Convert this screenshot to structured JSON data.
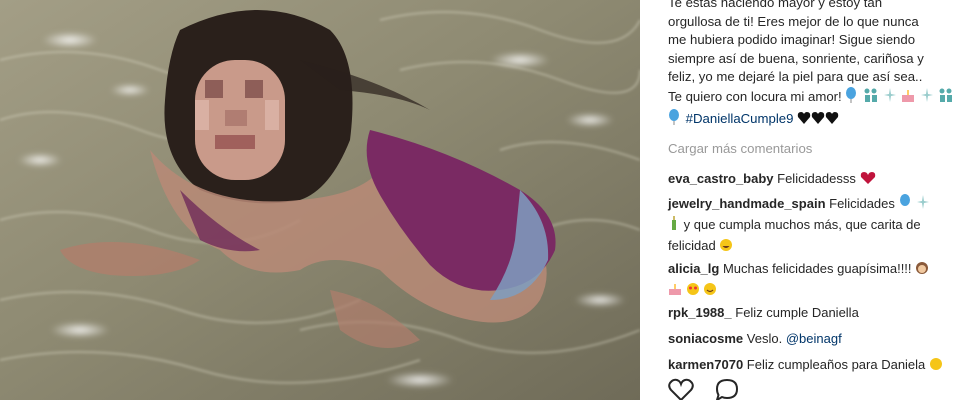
{
  "caption": {
    "lines": [
      "Te estás haciendo mayor y estoy tan",
      "orgullosa de ti! Eres mejor de lo que nunca",
      "me hubiera podido imaginar! Sigue siendo",
      "siempre así de buena, sonriente, cariñosa y",
      "feliz, yo me dejaré la piel para que así sea..",
      "Te quiero con locura mi amor!"
    ],
    "hashtag": "#DaniellaCumple9"
  },
  "load_more_label": "Cargar más comentarios",
  "comments": [
    {
      "user": "eva_castro_baby",
      "text": "Felicidadesss"
    },
    {
      "user": "jewelry_handmade_spain",
      "text": "Felicidades",
      "line2": "y que cumpla muchos más, que carita de",
      "line3": "felicidad"
    },
    {
      "user": "alicia_lg",
      "text": "Muchas felicidades guapísima!!!!"
    },
    {
      "user": "rpk_1988_",
      "text": "Feliz cumple Daniella"
    },
    {
      "user": "soniacosme",
      "text": "Veslo.",
      "mention": "@beinagf"
    },
    {
      "user": "karmen7070",
      "text": "Feliz cumpleaños para Daniela"
    }
  ],
  "icons": {
    "like": "heart-outline-icon",
    "comment": "comment-bubble-icon"
  },
  "colors": {
    "hashtag": "#003569",
    "muted": "#999999",
    "text": "#262626"
  }
}
